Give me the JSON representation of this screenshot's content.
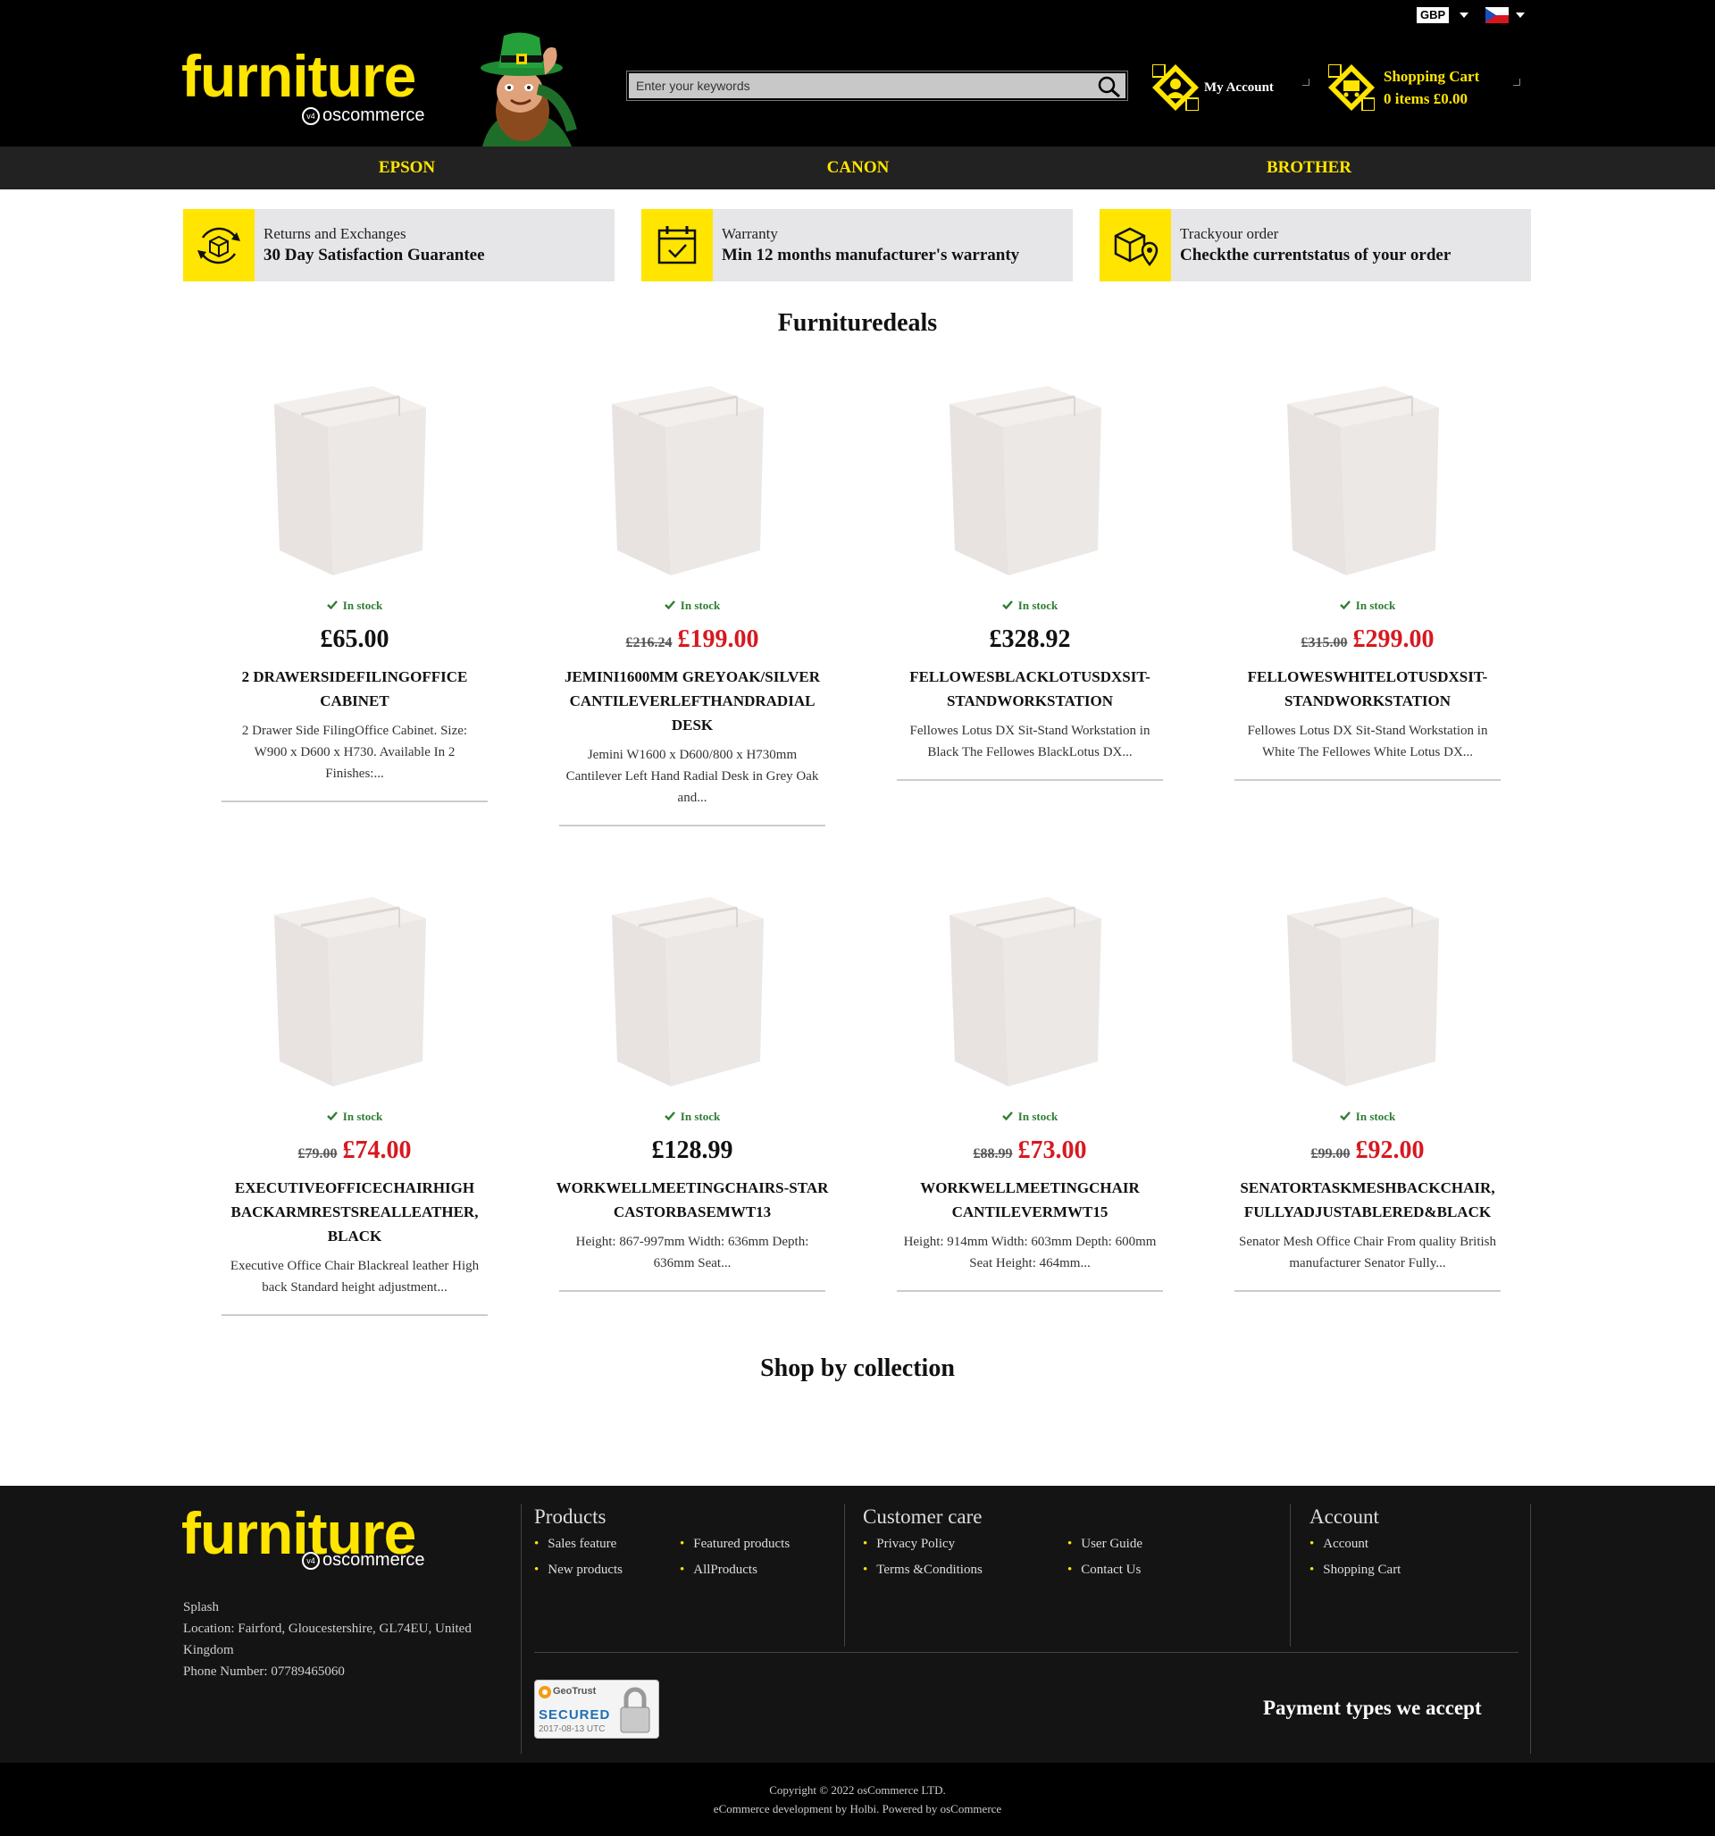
{
  "topbar": {
    "currency": "GBP",
    "language_flag_icon": "flag-icon"
  },
  "header": {
    "logo_word": "furniture",
    "logo_sub": "oscommerce",
    "logo_badge": "v4",
    "search_placeholder": "Enter your keywords",
    "account_label": "My Account",
    "cart_title": "Shopping Cart",
    "cart_summary": "0  items £0.00"
  },
  "nav": {
    "items": [
      "EPSON",
      "CANON",
      "BROTHER"
    ]
  },
  "features": [
    {
      "icon": "box-return-icon",
      "title": "Returns and Exchanges",
      "subtitle": "30  Day Satisfaction Guarantee"
    },
    {
      "icon": "calendar-check-icon",
      "title": "Warranty",
      "subtitle": "Min 12 months manufacturer's warranty"
    },
    {
      "icon": "box-location-icon",
      "title": "Trackyour order",
      "subtitle": "Checkthe currentstatus of your order"
    }
  ],
  "deals_heading": "Furnituredeals",
  "products": [
    {
      "stock": "In stock",
      "old_price": "",
      "price": "£65.00",
      "sale": false,
      "name": "2 DRAWERSIDEFILINGOFFICE CABINET",
      "desc": "2 Drawer Side FilingOffice Cabinet. Size: W900   x D600   x H730.  Available In 2 Finishes:..."
    },
    {
      "stock": "In stock",
      "old_price": "£216.24",
      "price": "£199.00",
      "sale": true,
      "name": "JEMINI1600MM GREYOAK/SILVER CANTILEVERLEFTHANDRADIAL DESK",
      "desc": "Jemini W1600   x D600/800     x H730mm Cantilever Left Hand  Radial Desk in Grey Oak and..."
    },
    {
      "stock": "In stock",
      "old_price": "",
      "price": "£328.92",
      "sale": false,
      "name": "FELLOWESBLACKLOTUSDXSIT-STANDWORKSTATION",
      "desc": "Fellowes Lotus DX Sit-Stand  Workstation  in Black The Fellowes BlackLotus DX..."
    },
    {
      "stock": "In stock",
      "old_price": "£315.00",
      "price": "£299.00",
      "sale": true,
      "name": "FELLOWESWHITELOTUSDXSIT-STANDWORKSTATION",
      "desc": "Fellowes Lotus DX Sit-Stand  Workstation  in White  The Fellowes White Lotus DX..."
    },
    {
      "stock": "In stock",
      "old_price": "£79.00",
      "price": "£74.00",
      "sale": true,
      "name": "EXECUTIVEOFFICECHAIRHIGH BACKARMRESTSREALLEATHER, BLACK",
      "desc": "Executive Office Chair Blackreal leather High back Standard  height adjustment..."
    },
    {
      "stock": "In stock",
      "old_price": "",
      "price": "£128.99",
      "sale": false,
      "name": "WORKWELLMEETINGCHAIRS-STAR CASTORBASEMWT13",
      "desc": "Height: 867-997mm  Width: 636mm Depth: 636mm    Seat..."
    },
    {
      "stock": "In stock",
      "old_price": "£88.99",
      "price": "£73.00",
      "sale": true,
      "name": "WORKWELLMEETINGCHAIR CANTILEVERMWT15",
      "desc": "Height: 914mm  Width: 603mm Depth: 600mm     Seat Height: 464mm..."
    },
    {
      "stock": "In stock",
      "old_price": "£99.00",
      "price": "£92.00",
      "sale": true,
      "name": "SENATORTASKMESHBACKCHAIR, FULLYADJUSTABLERED&BLACK",
      "desc": "Senator  Mesh Office Chair From quality British manufacturer Senator   Fully..."
    }
  ],
  "collection_heading": "Shop by collection",
  "footer": {
    "company": "Splash",
    "location": "Location: Fairford, Gloucestershire,  GL74EU, United Kingdom",
    "phone": "Phone  Number:  07789465060",
    "products_heading": "Products",
    "products_links": [
      "Sales feature",
      "New products",
      "Featured products",
      "AllProducts"
    ],
    "care_heading": "Customer  care",
    "care_links": [
      "Privacy Policy",
      "Terms &Conditions",
      "User Guide",
      "Contact Us"
    ],
    "account_heading": "Account",
    "account_links": [
      "Account",
      "Shopping  Cart"
    ],
    "geotrust_brand": "GeoTrust",
    "geotrust_secured": "SECURED",
    "geotrust_date": "2017-08-13 UTC",
    "payment_heading": "Payment types we accept",
    "copyright": "Copyright © 2022  osCommerce  LTD.",
    "credits": "eCommerce  development   by Holbi. Powered  by osCommerce"
  }
}
